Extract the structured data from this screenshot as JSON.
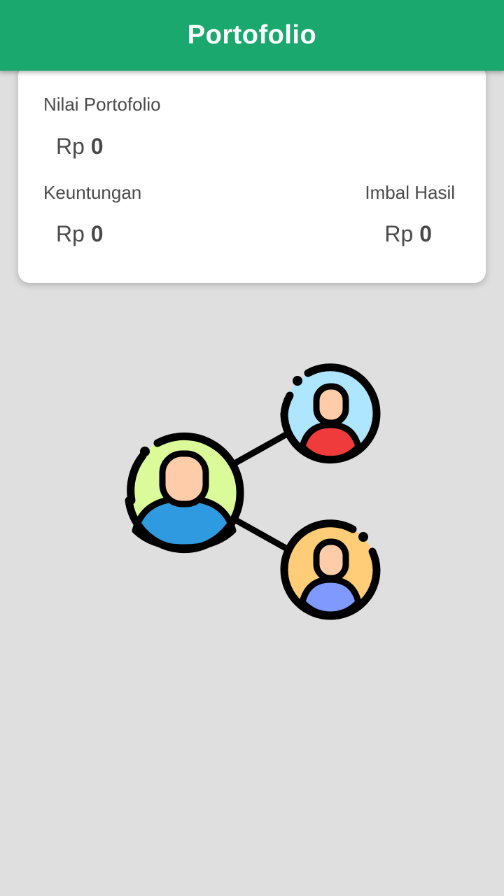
{
  "header": {
    "title": "Portofolio"
  },
  "summary": {
    "portfolio_value": {
      "label": "Nilai Portofolio",
      "currency": "Rp",
      "amount": "0"
    },
    "profit": {
      "label": "Keuntungan",
      "currency": "Rp",
      "amount": "0"
    },
    "return": {
      "label": "Imbal Hasil",
      "currency": "Rp",
      "amount": "0"
    }
  },
  "colors": {
    "app_bar": "#1aa86e",
    "background": "#dfdfdf",
    "card": "#ffffff",
    "text": "#4a4a4a"
  },
  "illustration": {
    "icon": "network-users-icon"
  }
}
